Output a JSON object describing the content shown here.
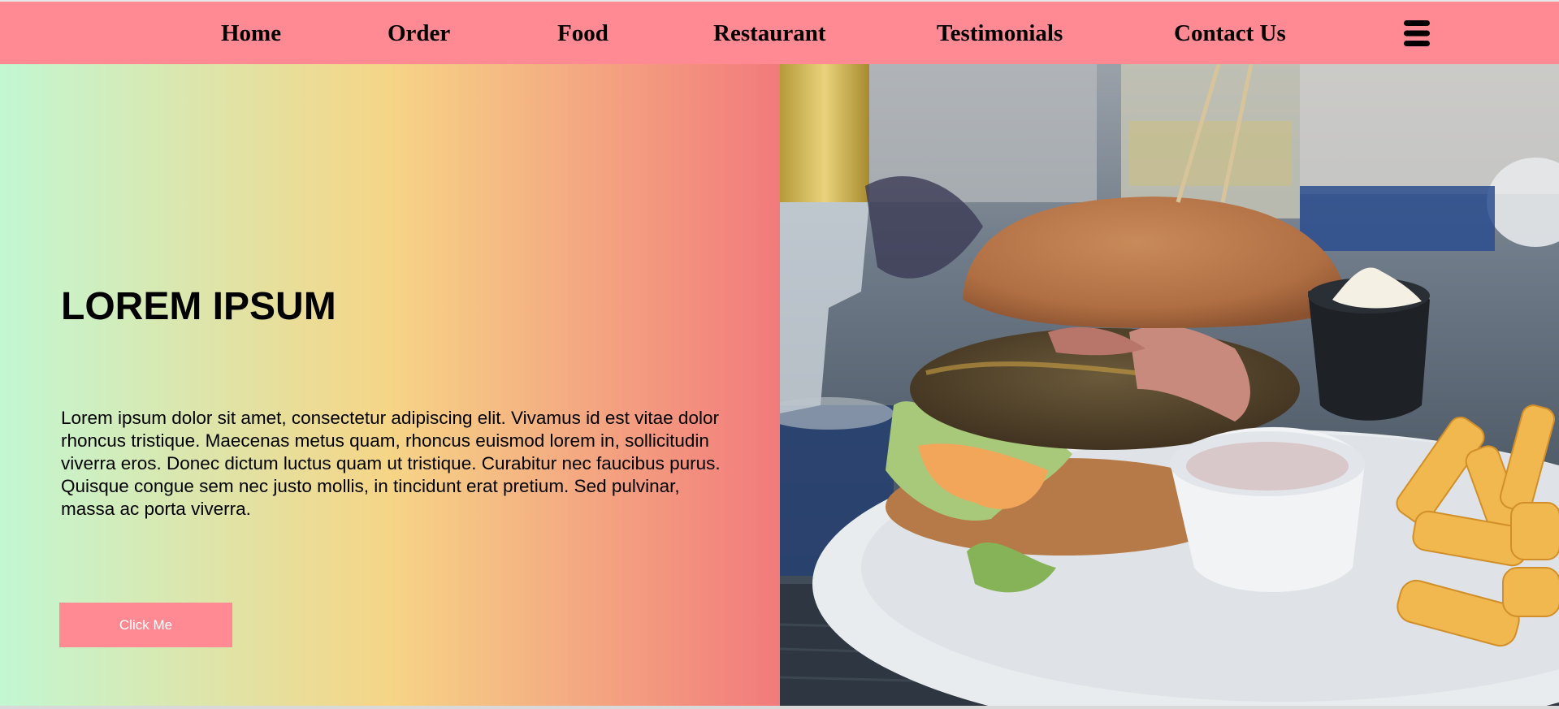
{
  "nav": {
    "links": [
      {
        "label": "Home"
      },
      {
        "label": "Order"
      },
      {
        "label": "Food"
      },
      {
        "label": "Restaurant"
      },
      {
        "label": "Testimonials"
      },
      {
        "label": "Contact Us"
      }
    ],
    "menu_icon": "hamburger-menu-icon",
    "background": "#ff8a93"
  },
  "hero": {
    "title": "LOREM IPSUM",
    "text": "Lorem ipsum dolor sit amet, consectetur adipiscing elit. Vivamus id est vitae dolor rhoncus tristique. Maecenas metus quam, rhoncus euismod lorem in, sollicitudin viverra eros. Donec dictum luctus quam ut tristique. Curabitur nec faucibus purus. Quisque congue sem nec justo mollis, in tincidunt erat pretium. Sed pulvinar, massa ac porta viverra.",
    "button_label": "Click Me",
    "gradient": [
      "#c2f7d2",
      "#f6d586",
      "#f27a7c"
    ],
    "button_color": "#ff8a93"
  },
  "photo": {
    "subject": "burger with fries and dipping sauces on a plate"
  }
}
